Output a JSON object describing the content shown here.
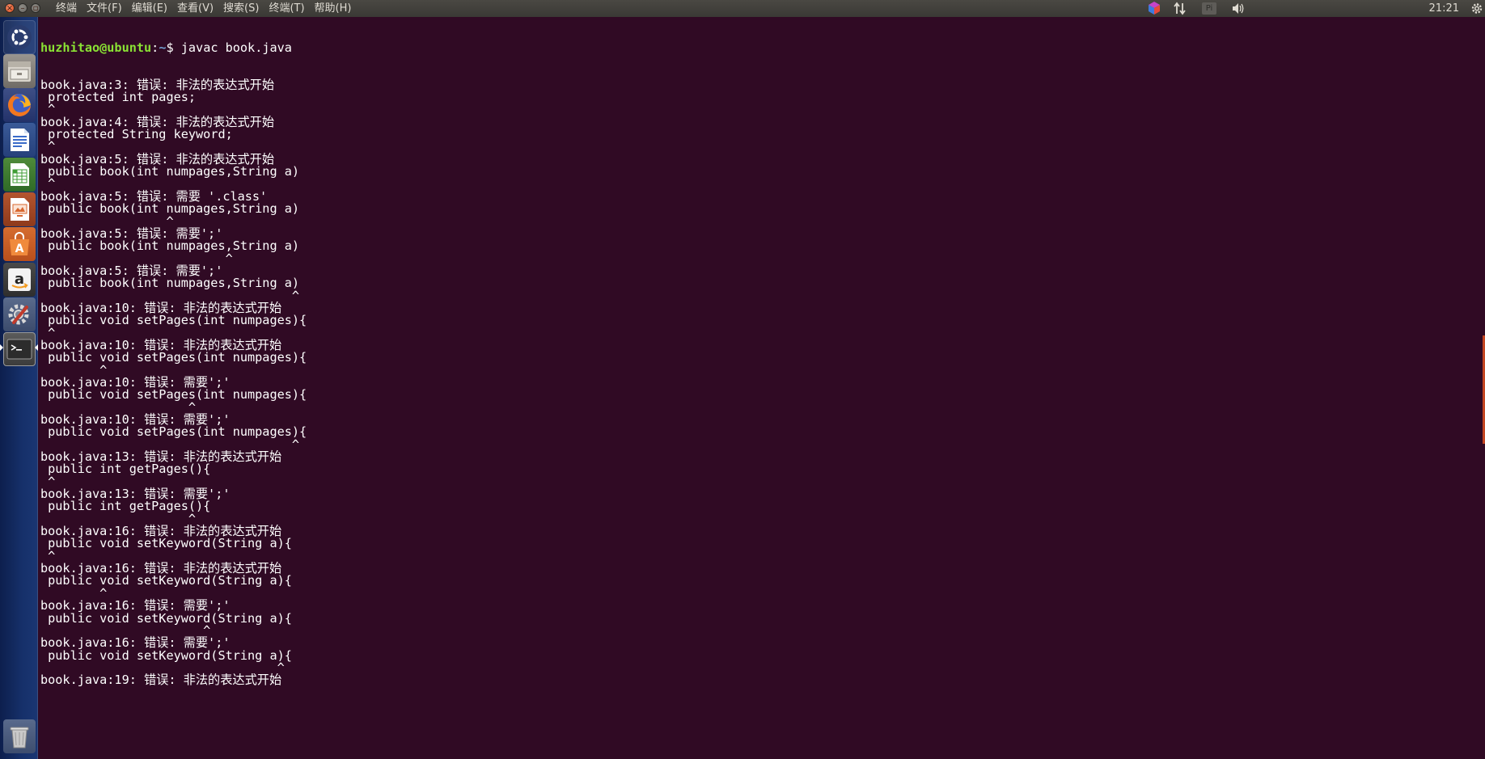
{
  "window": {
    "close_glyph": "×",
    "min_glyph": "–",
    "max_glyph": "▫"
  },
  "menu": [
    {
      "label": "终端"
    },
    {
      "label": "文件(F)"
    },
    {
      "label": "编辑(E)"
    },
    {
      "label": "查看(V)"
    },
    {
      "label": "搜索(S)"
    },
    {
      "label": "终端(T)"
    },
    {
      "label": "帮助(H)"
    }
  ],
  "tray": {
    "input_method": "Pi",
    "time": "21:21",
    "icons": [
      "indicator-cube-icon",
      "network-arrows-icon",
      "input-method-icon",
      "volume-icon",
      "settings-gear-icon"
    ]
  },
  "launcher": {
    "items": [
      {
        "name": "ubuntu-dash-icon"
      },
      {
        "name": "files-icon"
      },
      {
        "name": "firefox-icon"
      },
      {
        "name": "writer-icon"
      },
      {
        "name": "calc-icon"
      },
      {
        "name": "impress-icon"
      },
      {
        "name": "software-center-icon"
      },
      {
        "name": "amazon-icon"
      },
      {
        "name": "system-settings-icon"
      },
      {
        "name": "terminal-icon"
      }
    ],
    "trash": {
      "name": "trash-icon"
    }
  },
  "colors": {
    "terminal_bg": "#300a24",
    "prompt_user": "#8ae234",
    "prompt_path": "#729fcf",
    "text": "#ffffff",
    "accent": "#e95420"
  },
  "terminal": {
    "prompt": {
      "user_host": "huzhitao@ubuntu",
      "separator": ":",
      "path": "~",
      "symbol": "$",
      "command": " javac book.java"
    },
    "lines": [
      "book.java:3: 错误: 非法的表达式开始",
      " protected int pages;",
      " ^",
      "book.java:4: 错误: 非法的表达式开始",
      " protected String keyword;",
      " ^",
      "book.java:5: 错误: 非法的表达式开始",
      " public book(int numpages,String a)",
      " ^",
      "book.java:5: 错误: 需要 '.class'",
      " public book(int numpages,String a)",
      "                 ^",
      "book.java:5: 错误: 需要';'",
      " public book(int numpages,String a)",
      "                         ^",
      "book.java:5: 错误: 需要';'",
      " public book(int numpages,String a)",
      "                                  ^",
      "book.java:10: 错误: 非法的表达式开始",
      " public void setPages(int numpages){",
      " ^",
      "book.java:10: 错误: 非法的表达式开始",
      " public void setPages(int numpages){",
      "        ^",
      "book.java:10: 错误: 需要';'",
      " public void setPages(int numpages){",
      "                    ^",
      "book.java:10: 错误: 需要';'",
      " public void setPages(int numpages){",
      "                                  ^",
      "book.java:13: 错误: 非法的表达式开始",
      " public int getPages(){",
      " ^",
      "book.java:13: 错误: 需要';'",
      " public int getPages(){",
      "                    ^",
      "book.java:16: 错误: 非法的表达式开始",
      " public void setKeyword(String a){",
      " ^",
      "book.java:16: 错误: 非法的表达式开始",
      " public void setKeyword(String a){",
      "        ^",
      "book.java:16: 错误: 需要';'",
      " public void setKeyword(String a){",
      "                      ^",
      "book.java:16: 错误: 需要';'",
      " public void setKeyword(String a){",
      "                                ^",
      "book.java:19: 错误: 非法的表达式开始"
    ]
  }
}
